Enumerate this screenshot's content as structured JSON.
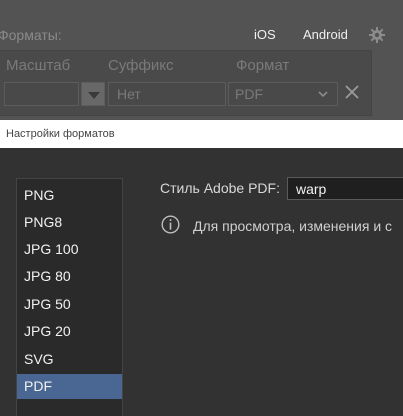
{
  "background_panel": {
    "title": "Форматы:",
    "tabs": [
      "iOS",
      "Android"
    ],
    "columns": [
      "Масштаб",
      "Суффикс",
      "Формат"
    ],
    "row": {
      "scale": "",
      "suffix_placeholder": "Нет",
      "format": "PDF"
    }
  },
  "dialog": {
    "title": "Настройки форматов",
    "formats": [
      {
        "label": "PNG",
        "selected": false
      },
      {
        "label": "PNG8",
        "selected": false
      },
      {
        "label": "JPG 100",
        "selected": false
      },
      {
        "label": "JPG 80",
        "selected": false
      },
      {
        "label": "JPG 50",
        "selected": false
      },
      {
        "label": "JPG 20",
        "selected": false
      },
      {
        "label": "SVG",
        "selected": false
      },
      {
        "label": "PDF",
        "selected": true
      }
    ],
    "pdf_style_label": "Стиль Adobe PDF:",
    "pdf_style_value": "warp",
    "info_text": "Для просмотра, изменения и с"
  },
  "colors": {
    "selection": "#4a6794",
    "panel": "#535353",
    "dialog_bg": "#323232"
  }
}
